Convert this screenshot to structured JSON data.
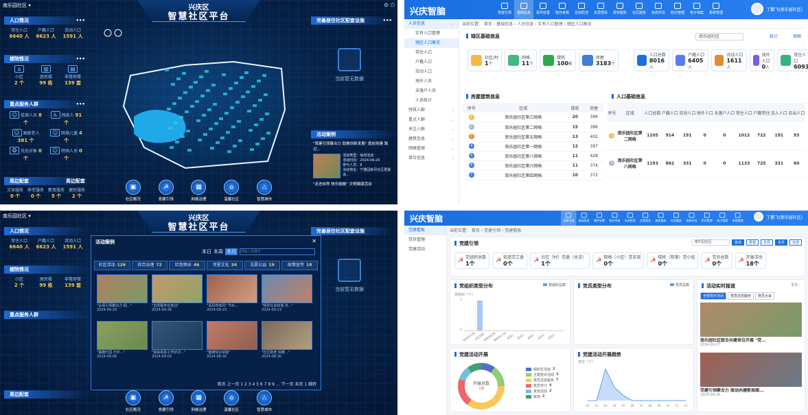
{
  "dash": {
    "location": "南乐园社区 ▾",
    "city": "兴庆区",
    "title": "智慧社区平台",
    "left": {
      "p1": {
        "title": "人口情况",
        "items": [
          {
            "label": "常住人口",
            "value": "6640 人"
          },
          {
            "label": "户籍人口",
            "value": "6623 人"
          },
          {
            "label": "流动人口",
            "value": "1591 人"
          }
        ]
      },
      "p2": {
        "title": "楼院情况",
        "items": [
          {
            "label": "小区",
            "value": "2 个"
          },
          {
            "label": "居民楼",
            "value": "99 栋"
          },
          {
            "label": "非楼房楼",
            "value": "139 套"
          }
        ]
      },
      "p3": {
        "title": "重点服务人群",
        "items": [
          {
            "label": "低保人员",
            "value": "8 个"
          },
          {
            "label": "残疾人",
            "value": "91 个"
          },
          {
            "label": "高龄老人",
            "value": "381 个"
          },
          {
            "label": "困境儿童",
            "value": "4 个"
          },
          {
            "label": "优抚对象",
            "value": "0 个"
          },
          {
            "label": "特困人员",
            "value": "0 个"
          }
        ]
      },
      "p4": {
        "title": "周边配套",
        "more": "周边配套",
        "items": [
          {
            "label": "文体服务",
            "value": "0 个"
          },
          {
            "label": "养老服务",
            "value": "0 个"
          },
          {
            "label": "教育服务",
            "value": "5 个"
          },
          {
            "label": "便民服务",
            "value": "2 个"
          }
        ]
      }
    },
    "right": {
      "t1": "完善居住社区配套设施",
      "nodata": "当前暂无数据",
      "t2": "活动案例",
      "case": "\"贸建引领聚合力 助推创新发展\" 提前党建 路过...",
      "rows": [
        "活动类型：休闲活动",
        "活动时间：2024-09-29",
        "参与人员：8",
        "活动地址：宁雅园新月社区居委会..."
      ],
      "case2": "\"走进自然 快乐融融\" 文明健康活动"
    },
    "nav": [
      "社区概况",
      "党建引领",
      "网格治理",
      "温馨社区",
      "智慧城市"
    ],
    "modal": {
      "title": "活动案例",
      "filters": [
        "本日",
        "本周",
        "本月"
      ],
      "search_ph": "请输入关键字",
      "tabs": [
        {
          "l": "社区活动",
          "n": "126"
        },
        {
          "l": "综合治理",
          "n": "72"
        },
        {
          "l": "红色物业",
          "n": "46"
        },
        {
          "l": "邻里文化",
          "n": "34"
        },
        {
          "l": "志愿公益",
          "n": "19"
        },
        {
          "l": "政策宣传",
          "n": "18"
        }
      ],
      "photos": [
        {
          "t": "\"弘扬引领聚合力 助...\"",
          "d": "2024-09-29"
        },
        {
          "t": "\"志愿服务在身边\"",
          "d": "2024-09-26"
        },
        {
          "t": "\"清风传家风\" 节水...",
          "d": "2024-09-23"
        },
        {
          "t": "\"我爱社会和谐 共...\"",
          "d": "2024-09-23"
        },
        {
          "t": "\"童趣乐园 巧手...\"",
          "d": "2024-09-06"
        },
        {
          "t": "\"我来看看工作状况...\"",
          "d": "2024-09-03"
        },
        {
          "t": "\"健康知识讲座\"",
          "d": "2024-08-30"
        },
        {
          "t": "\"社区助老 情暖...\"",
          "d": "2024-08-30"
        }
      ],
      "pager": "首页  上一页  1 2 3 4 5 6 7 8 9 ...  下一页  末页  1  跳转"
    }
  },
  "admin": {
    "brand": "兴庆智脑",
    "modules": [
      "党建引领",
      "基础信息",
      "事件处置",
      "智办考核",
      "治安防范",
      "关爱帮扶",
      "政务服务",
      "社区服务",
      "协商共治",
      "积分管理",
      "电子档案",
      "系统管理"
    ],
    "user": "丁鹏飞(南乐园社区)",
    "menu": [
      {
        "l": "人员信息",
        "on": true
      },
      {
        "l": "实有人口管理",
        "sub": true
      },
      {
        "l": "辖区人口概览",
        "sub": true,
        "on": true
      },
      {
        "l": "常住人口",
        "sub": true
      },
      {
        "l": "户籍人口",
        "sub": true
      },
      {
        "l": "流动人口",
        "sub": true
      },
      {
        "l": "境外人员",
        "sub": true
      },
      {
        "l": "未落户人员",
        "sub": true
      },
      {
        "l": "人员统计",
        "sub": true
      },
      {
        "l": "特殊人群"
      },
      {
        "l": "重点人群"
      },
      {
        "l": "关注人群"
      },
      {
        "l": "建筑信息"
      },
      {
        "l": "网格管理"
      },
      {
        "l": "单位信息"
      }
    ],
    "crumb": "当前位置： 首页 › 基础信息 › 人员信息 › 实有人口管理 › 辖区人口概览",
    "base_title": "辖区基础信息",
    "select": "南乐园社区",
    "stat_btn": "统计",
    "map_btn": "地图",
    "stats": [
      {
        "l": "社区/村",
        "v": "1",
        "u": "个"
      },
      {
        "l": "网格",
        "v": "11",
        "u": "个"
      },
      {
        "l": "楼栋",
        "v": "100",
        "u": "栋"
      },
      {
        "l": "房屋",
        "v": "3183",
        "u": "个"
      }
    ],
    "pstats": [
      {
        "l": "人口总数",
        "v": "8016",
        "u": "人"
      },
      {
        "l": "户籍人口",
        "v": "6405",
        "u": "人"
      },
      {
        "l": "流动人口",
        "v": "1611",
        "u": "人"
      },
      {
        "l": "境外人口",
        "v": "0",
        "u": "人"
      },
      {
        "l": "常住人口",
        "v": "6093",
        "u": ""
      }
    ],
    "house_title": "房屋建筑信息",
    "house_cols": [
      "序号",
      "区域",
      "楼栋",
      "房屋"
    ],
    "houses": [
      [
        "南乐园社区第三网格",
        "20",
        "396"
      ],
      [
        "南乐园社区第二网格",
        "15",
        "396"
      ],
      [
        "南乐园社区第五网格",
        "13",
        "402"
      ],
      [
        "南乐园社区第一网格",
        "12",
        "397"
      ],
      [
        "南乐园社区第八网格",
        "11",
        "428"
      ],
      [
        "南乐园社区第六网格",
        "11",
        "374"
      ],
      [
        "南乐园社区第四网格",
        "10",
        "372"
      ]
    ],
    "pop_title": "人口基础信息",
    "pop_cols": [
      "序号",
      "区域",
      "人口总数",
      "户籍人口",
      "流动人口",
      "境外人口",
      "未落户人口",
      "常住人口",
      "户籍常住",
      "流入人口",
      "流出人口"
    ],
    "pops": [
      [
        "南乐园社区第二网格",
        "1105",
        "914",
        "191",
        "0",
        "0",
        "1012",
        "722",
        "191",
        "93"
      ],
      [
        "南乐园社区第八网格",
        "1193",
        "862",
        "331",
        "0",
        "0",
        "1133",
        "725",
        "331",
        "60"
      ]
    ]
  },
  "party": {
    "brand": "兴庆智脑",
    "crumb": "当前位置： 首页 › 党建引领 › 党建看板",
    "menu": [
      "党建看板",
      "党员管理",
      "党建活动"
    ],
    "title": "党建引领",
    "select": "南乐园社区",
    "btns": [
      "查询",
      "重置",
      "本周",
      "本月",
      "全部"
    ],
    "stats": [
      {
        "l": "党组织总数",
        "v": "1个"
      },
      {
        "l": "街道党工委",
        "v": "0个"
      },
      {
        "l": "社区（村）党委（总支）",
        "v": "1个"
      },
      {
        "l": "网格（小区）党支部",
        "v": "0个"
      },
      {
        "l": "楼栋（院落）党小组",
        "v": "0个"
      },
      {
        "l": "党员总数",
        "v": "0个"
      },
      {
        "l": "开展活动",
        "v": "18个"
      }
    ],
    "c1": "党组织类型分布",
    "c1l": "党组织总数",
    "c1y": "党组织（个）",
    "c2": "党员类型分布",
    "c2l": "党员总数",
    "c3": "党建活动开展",
    "c3c": "开展总数",
    "c3n": "18",
    "c4": "党建活动开展趋势",
    "c4y": "单位（个）",
    "legend": [
      {
        "l": "组织生活会",
        "v": "2",
        "c": "#5470c6"
      },
      {
        "l": "主题党日活动",
        "v": "3",
        "c": "#91cc75"
      },
      {
        "l": "党员志愿服务",
        "v": "7",
        "c": "#fac858"
      },
      {
        "l": "党员学习",
        "v": "4",
        "c": "#ee6666"
      },
      {
        "l": "其他活动",
        "v": "2",
        "c": "#73c0de"
      },
      {
        "l": "其他",
        "v": "2",
        "c": "#3ba272"
      }
    ],
    "news_t": "活动实时报道",
    "news_more": "更多 ›",
    "news_tabs": [
      "全部党日活动",
      "党员志愿服务",
      "党员大会"
    ],
    "news": [
      {
        "t": "南乐园社区联合共建单位开展 \"党...",
        "d": "2024-09-27"
      },
      {
        "t": "党建引领聚合力 联动共建新局面...",
        "d": "2024-09-26"
      }
    ]
  },
  "chart_data": [
    {
      "type": "bar",
      "title": "党组织类型分布",
      "categories": [
        "街道党工委",
        "社区党委",
        "网格党支部",
        "楼栋党小组",
        "其他1",
        "其他2",
        "其他3",
        "其他4",
        "其他5"
      ],
      "values": [
        0,
        1,
        0,
        0,
        0,
        0,
        0,
        0,
        0
      ],
      "ylim": [
        0,
        1
      ],
      "ylabel": "党组织（个）"
    },
    {
      "type": "line",
      "title": "党建活动开展趋势",
      "x": [
        "01",
        "02",
        "03",
        "04",
        "05",
        "06",
        "07",
        "08",
        "09",
        "10",
        "11",
        "12"
      ],
      "values": [
        0,
        0,
        12,
        5,
        2,
        0,
        0,
        0,
        0,
        0,
        0,
        0
      ],
      "ylabel": "单位（个）"
    },
    {
      "type": "pie",
      "title": "党建活动开展",
      "categories": [
        "组织生活会",
        "主题党日活动",
        "党员志愿服务",
        "党员学习",
        "其他活动",
        "其他"
      ],
      "values": [
        2,
        3,
        7,
        4,
        2,
        2
      ]
    }
  ]
}
